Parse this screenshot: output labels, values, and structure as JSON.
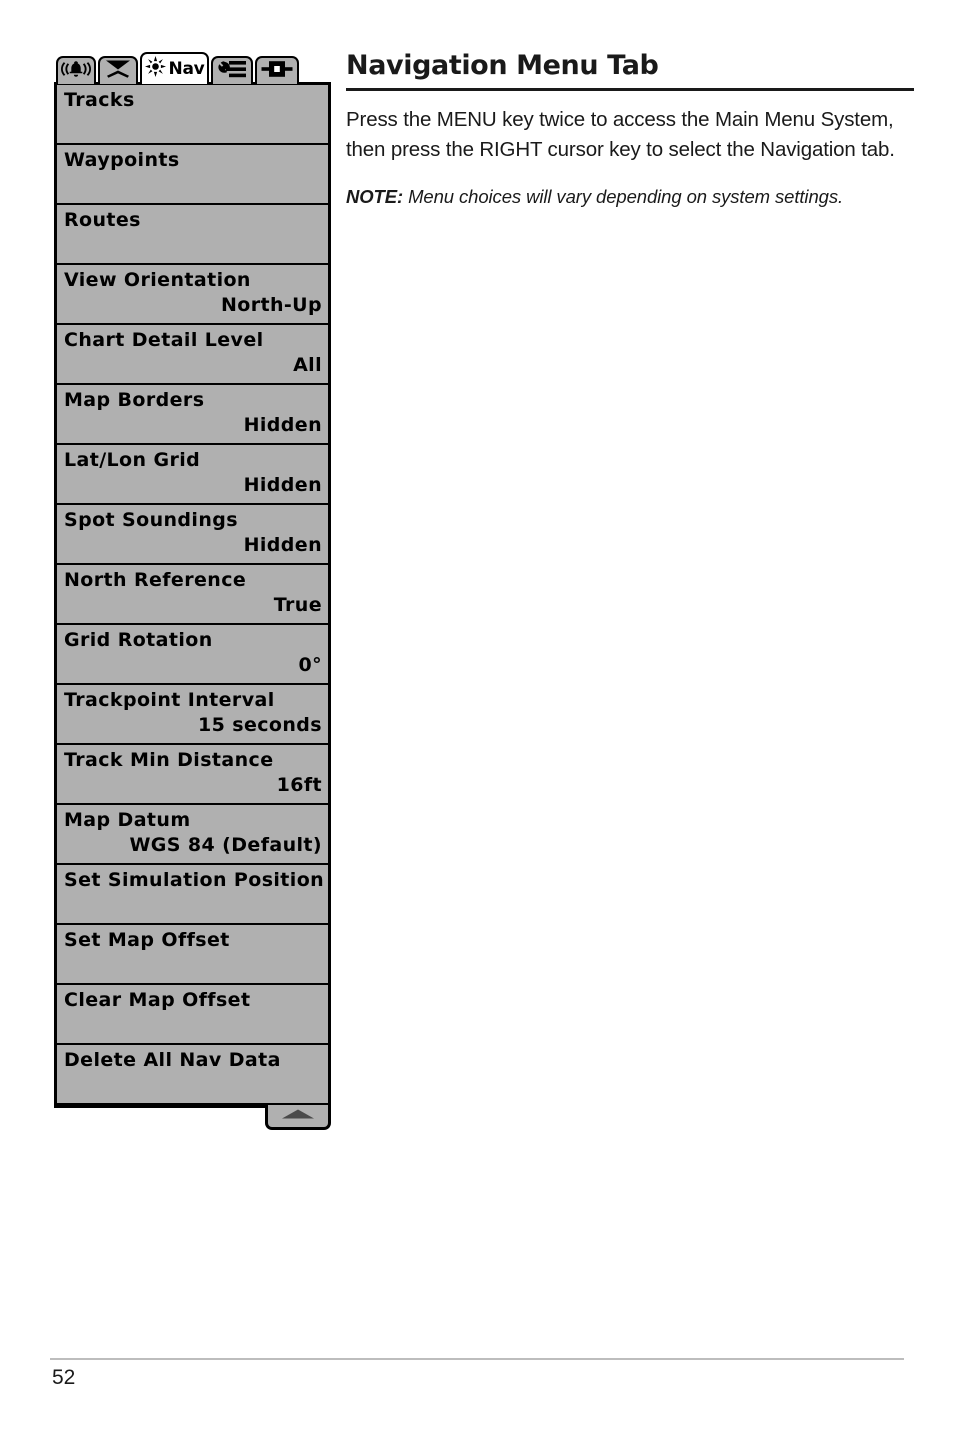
{
  "page": {
    "number": "52"
  },
  "article": {
    "title": "Navigation Menu Tab",
    "paragraph": "Press the MENU key twice to access the Main Menu System, then press the RIGHT cursor key to select the Navigation tab.",
    "note_label": "NOTE:",
    "note_text": " Menu choices will vary depending on system settings."
  },
  "device": {
    "tabs": [
      {
        "id": "alarms",
        "icon": "bell-icon",
        "label": "",
        "active": false
      },
      {
        "id": "sonar",
        "icon": "sonar-icon",
        "label": "",
        "active": false
      },
      {
        "id": "navigation",
        "icon": "compass-icon",
        "label": "Nav",
        "active": true
      },
      {
        "id": "setup",
        "icon": "wrench-icon",
        "label": "",
        "active": false
      },
      {
        "id": "views",
        "icon": "display-icon",
        "label": "",
        "active": false
      }
    ],
    "menu_items": [
      {
        "label": "Tracks",
        "value": ""
      },
      {
        "label": "Waypoints",
        "value": ""
      },
      {
        "label": "Routes",
        "value": ""
      },
      {
        "label": "View Orientation",
        "value": "North-Up"
      },
      {
        "label": "Chart Detail Level",
        "value": "All"
      },
      {
        "label": "Map Borders",
        "value": "Hidden"
      },
      {
        "label": "Lat/Lon Grid",
        "value": "Hidden"
      },
      {
        "label": "Spot Soundings",
        "value": "Hidden"
      },
      {
        "label": "North Reference",
        "value": "True"
      },
      {
        "label": "Grid Rotation",
        "value": "0°"
      },
      {
        "label": "Trackpoint Interval",
        "value": "15 seconds"
      },
      {
        "label": "Track Min Distance",
        "value": "16ft"
      },
      {
        "label": "Map Datum",
        "value": "WGS 84 (Default)"
      },
      {
        "label": "Set Simulation Position",
        "value": ""
      },
      {
        "label": "Set Map Offset",
        "value": ""
      },
      {
        "label": "Clear Map Offset",
        "value": ""
      },
      {
        "label": "Delete All Nav Data",
        "value": ""
      }
    ],
    "scroll_indicator": "scroll-up-arrow"
  },
  "colors": {
    "lcd_background": "#b0b0b0",
    "lcd_outline": "#000000",
    "active_tab_background": "#ffffff",
    "text": "#1a1a1a",
    "footer_rule": "#bdbdbd"
  }
}
